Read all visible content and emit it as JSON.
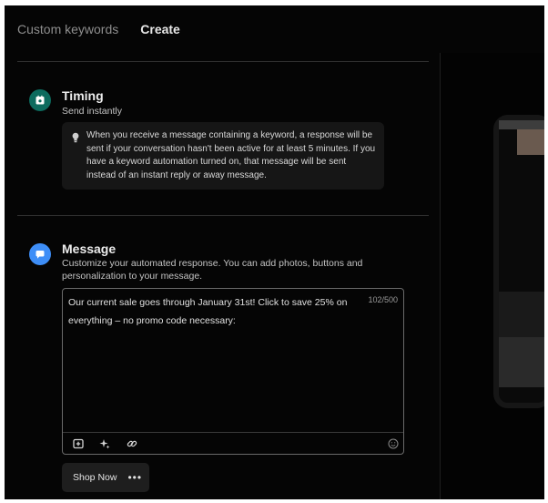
{
  "header": {
    "breadcrumb_parent": "Custom keywords",
    "breadcrumb_current": "Create"
  },
  "timing": {
    "title": "Timing",
    "subtitle": "Send instantly",
    "info": "When you receive a message containing a keyword, a response will be sent if your conversation hasn't been active for at least 5 minutes. If you have a keyword automation turned on, that message will be sent instead of an instant reply or away message.",
    "icon": "calendar-icon"
  },
  "message": {
    "title": "Message",
    "subtitle": "Customize your automated response. You can add photos, buttons and personalization to your message.",
    "icon": "chat-bubble-icon",
    "body": "Our current sale goes through January 31st! Click to save 25% on everything – no promo code necessary:",
    "char_count": "102/500",
    "toolbar_icons": [
      "add-photo-icon",
      "sparkle-icon",
      "link-icon",
      "emoji-icon"
    ]
  },
  "button": {
    "label": "Shop Now",
    "more": "•••"
  },
  "colors": {
    "background": "#050505",
    "timing_icon": "#0d6b5e",
    "message_icon": "#3e8ef7",
    "info_box": "#161616"
  }
}
